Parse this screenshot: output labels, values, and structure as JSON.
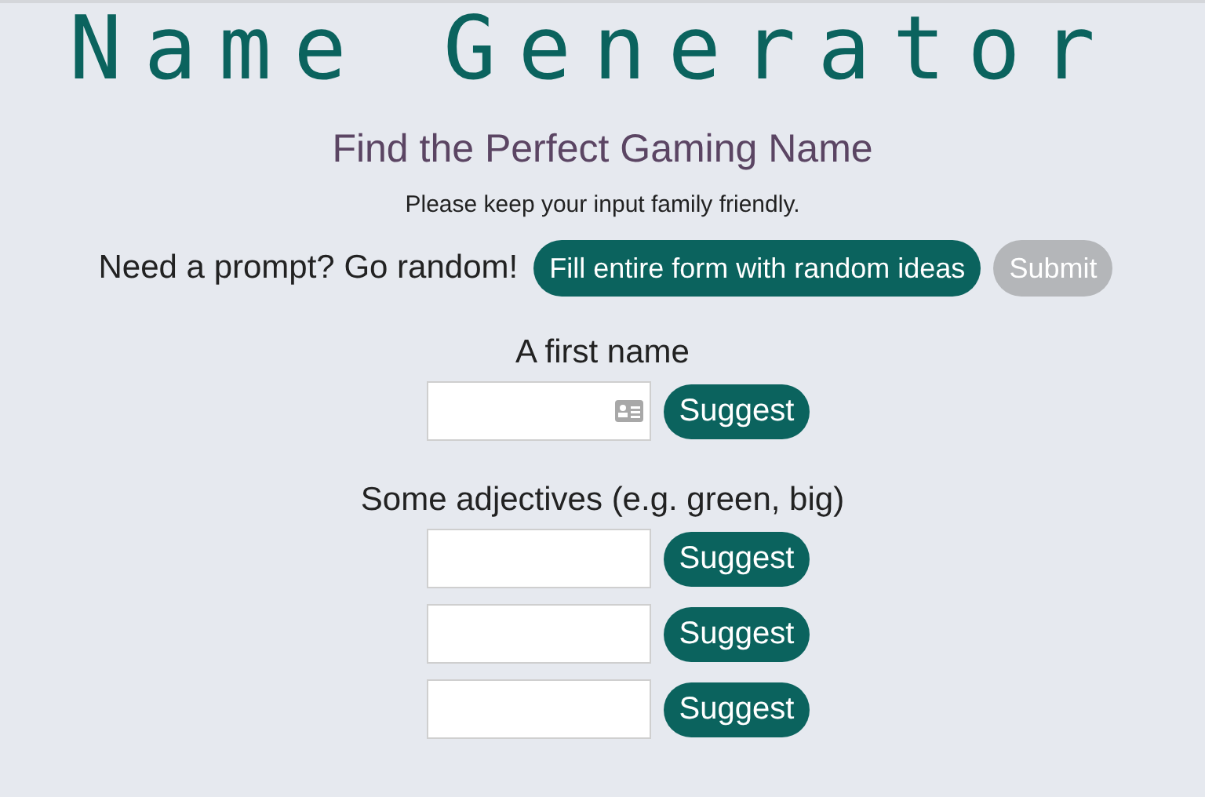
{
  "title": "Name Generator",
  "subtitle": "Find the Perfect Gaming Name",
  "notice": "Please keep your input family friendly.",
  "prompt": {
    "text": "Need a prompt? Go random!",
    "random_button": "Fill entire form with random ideas",
    "submit_button": {
      "label": "Submit",
      "disabled": true
    }
  },
  "fields": [
    {
      "label": "A first name",
      "inputs": [
        {
          "has_icon": true,
          "button": "Suggest"
        }
      ]
    },
    {
      "label": "Some adjectives (e.g. green, big)",
      "inputs": [
        {
          "has_icon": false,
          "button": "Suggest"
        },
        {
          "has_icon": false,
          "button": "Suggest"
        },
        {
          "has_icon": false,
          "button": "Suggest"
        }
      ]
    }
  ]
}
